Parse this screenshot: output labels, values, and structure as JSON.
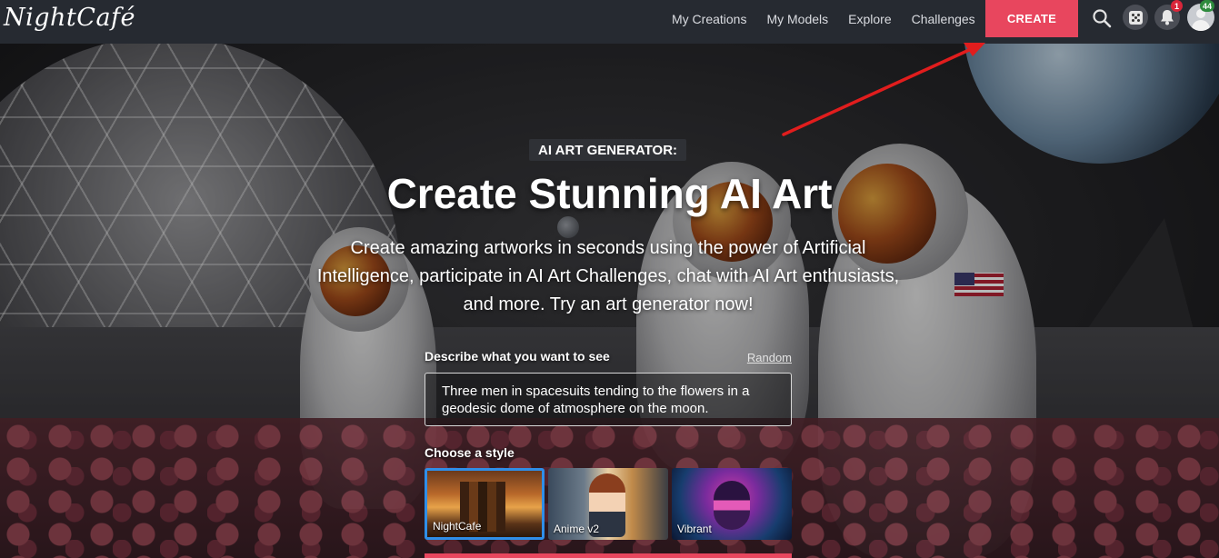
{
  "navbar": {
    "logo": "NightCafé",
    "links": [
      "My Creations",
      "My Models",
      "Explore",
      "Challenges"
    ],
    "create_label": "CREATE",
    "notification_count": "1",
    "user_level": "44"
  },
  "hero": {
    "eyebrow": "AI ART GENERATOR:",
    "title": "Create Stunning AI Art",
    "subtitle": "Create amazing artworks in seconds using the power of Artificial Intelligence, participate in AI Art Challenges, chat with AI Art enthusiasts, and more. Try an art generator now!"
  },
  "form": {
    "describe_label": "Describe what you want to see",
    "random_label": "Random",
    "prompt_value": "Three men in spacesuits tending to the flowers in a geodesic dome of atmosphere on the moon.",
    "style_label": "Choose a style",
    "styles": [
      {
        "name": "NightCafe",
        "selected": true
      },
      {
        "name": "Anime v2",
        "selected": false
      },
      {
        "name": "Vibrant",
        "selected": false
      }
    ]
  },
  "colors": {
    "accent": "#e8465e",
    "navbar_bg": "#262a31",
    "selected_border": "#2f8ee8",
    "annotation_arrow": "#e11d1d"
  }
}
